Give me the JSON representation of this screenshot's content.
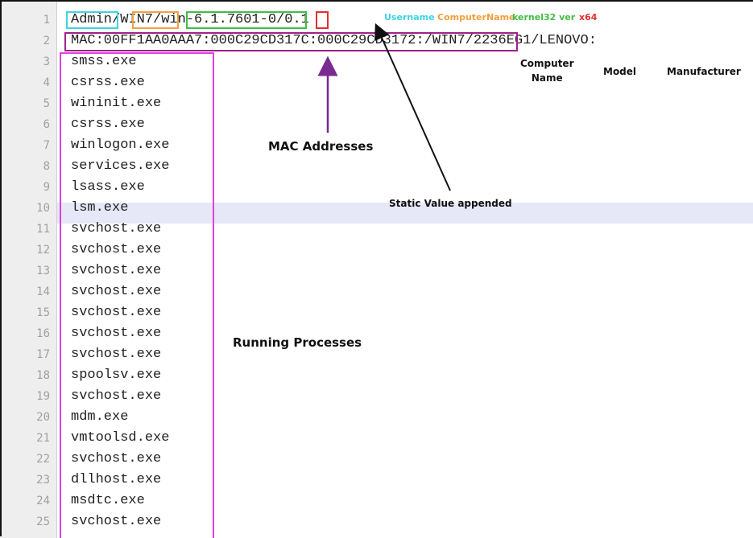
{
  "editor": {
    "line_numbers": [
      "1",
      "2",
      "3",
      "4",
      "5",
      "6",
      "7",
      "8",
      "9",
      "10",
      "11",
      "12",
      "13",
      "14",
      "15",
      "16",
      "17",
      "18",
      "19",
      "20",
      "21",
      "22",
      "23",
      "24",
      "25"
    ],
    "lines": [
      "Admin/WIN7/win-6.1.7601-0/0.1",
      "MAC:00FF1AA0AAA7:000C29CD317C:000C29CD3172:/WIN7/2236EG1/LENOVO:",
      "smss.exe",
      "csrss.exe",
      "wininit.exe",
      "csrss.exe",
      "winlogon.exe",
      "services.exe",
      "lsass.exe",
      "lsm.exe",
      "svchost.exe",
      "svchost.exe",
      "svchost.exe",
      "svchost.exe",
      "svchost.exe",
      "svchost.exe",
      "svchost.exe",
      "spoolsv.exe",
      "svchost.exe",
      "mdm.exe",
      "vmtoolsd.exe",
      "svchost.exe",
      "dllhost.exe",
      "msdtc.exe",
      "svchost.exe"
    ],
    "highlighted_line": "10"
  },
  "legend": {
    "username": "Username",
    "computer_name": "ComputerName",
    "kernel32_ver": "kernel32 ver",
    "arch": "x64"
  },
  "annotations": {
    "computer_name": "Computer\nName",
    "model": "Model",
    "manufacturer": "Manufacturer",
    "mac_addresses": "MAC Addresses",
    "static_value": "Static Value appended",
    "running_processes": "Running Processes"
  },
  "colors": {
    "username": "#3fd3e0",
    "computer_name": "#f0a040",
    "kernel32_ver": "#44bb44",
    "arch": "#e03030",
    "mac_box": "#a0208a",
    "process_box": "#e040e0",
    "arrow_purple": "#7a2a90"
  }
}
